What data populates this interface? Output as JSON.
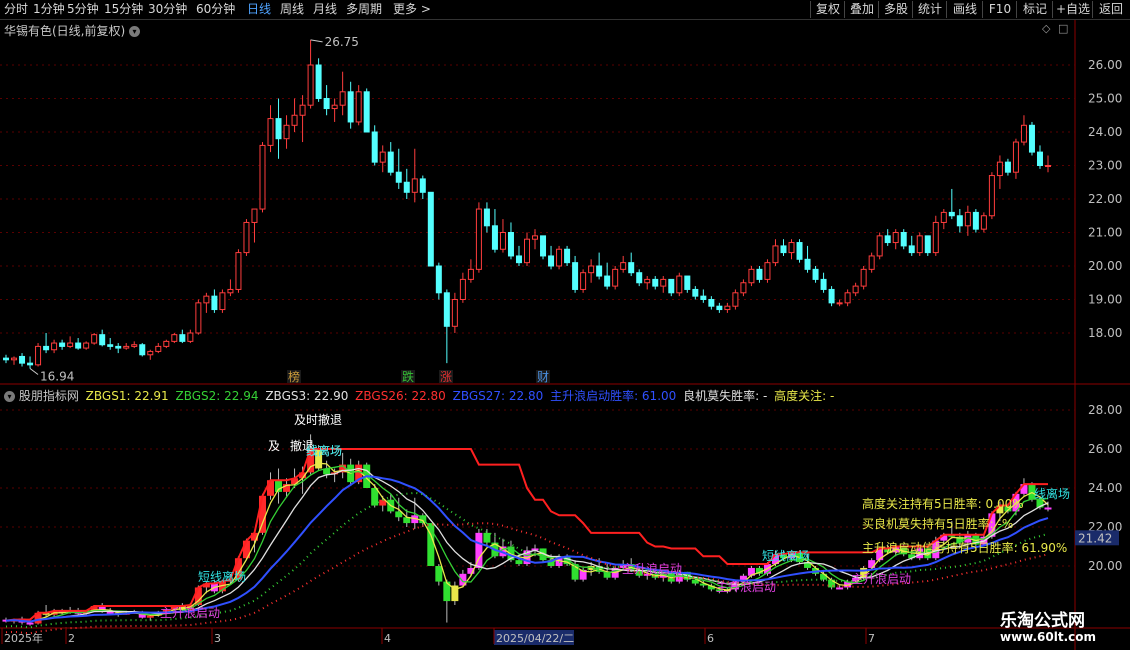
{
  "toolbar": {
    "timeframes": [
      "分时",
      "1分钟",
      "5分钟",
      "15分钟",
      "30分钟",
      "60分钟",
      "日线",
      "周线",
      "月线",
      "多周期",
      "更多"
    ],
    "active_timeframe": "日线",
    "right_buttons": [
      "复权",
      "叠加",
      "多股",
      "统计",
      "画线",
      "F10",
      "标记",
      "+自选",
      "返回"
    ]
  },
  "main_panel": {
    "title": "华锡有色(日线,前复权)",
    "y_ticks": [
      "26.00",
      "25.00",
      "24.00",
      "23.00",
      "22.00",
      "21.00",
      "20.00",
      "19.00",
      "18.00"
    ],
    "high_label": "26.75",
    "low_label": "16.94",
    "event_markers": [
      {
        "label": "榜",
        "color": "#c89a3a"
      },
      {
        "label": "跌",
        "color": "#35c035"
      },
      {
        "label": "涨",
        "color": "#e03030"
      },
      {
        "label": "财",
        "color": "#4a90e0"
      }
    ]
  },
  "indicator_panel": {
    "title": "股朋指标网",
    "legend": [
      {
        "text": "ZBGS1: 22.91",
        "color": "#e8e84a"
      },
      {
        "text": "ZBGS2: 22.94",
        "color": "#35d035"
      },
      {
        "text": "ZBGS3: 22.90",
        "color": "#e0e0e0"
      },
      {
        "text": "ZBGS26: 22.80",
        "color": "#ff3030"
      },
      {
        "text": "ZBGS27: 22.80",
        "color": "#3050ff"
      },
      {
        "text": "主升浪启动胜率: 61.00",
        "color": "#3050ff"
      },
      {
        "text": "良机莫失胜率: -",
        "color": "#e0e0e0"
      },
      {
        "text": "高度关注: -",
        "color": "#e8e84a"
      }
    ],
    "y_ticks": [
      "28.00",
      "26.00",
      "24.00",
      "22.00",
      "20.00"
    ],
    "current_value": "21.42",
    "signals": [
      {
        "text": "及时撤退",
        "color": "#ffffff"
      },
      {
        "text": "及",
        "color": "#ffffff"
      },
      {
        "text": "撤退",
        "color": "#ffffff"
      },
      {
        "text": "线离场",
        "color": "#ffffff"
      },
      {
        "text": "线离场",
        "color": "#30e0e0"
      },
      {
        "text": "短线离场",
        "color": "#30e0e0"
      },
      {
        "text": "短线离场",
        "color": "#30e0e0"
      },
      {
        "text": "主升浪启动",
        "color": "#e040e0"
      },
      {
        "text": "主升浪启动",
        "color": "#e040e0"
      },
      {
        "text": "主升浪启动",
        "color": "#e040e0"
      },
      {
        "text": "主升浪启动",
        "color": "#e040e0"
      }
    ],
    "stats": [
      {
        "text": "高度关注持有5日胜率:  0.00%",
        "color": "#e8e84a"
      },
      {
        "text": "买良机莫失持有5日胜率: -%",
        "color": "#e8e84a"
      },
      {
        "text": "主升浪启动信号持有5日胜率:  61.90%",
        "color": "#e8e84a"
      }
    ]
  },
  "x_axis": {
    "labels": [
      "2025年",
      "2",
      "3",
      "4",
      "2025/04/22/二",
      "6",
      "7"
    ]
  },
  "watermark": {
    "title": "乐淘公式网",
    "url": "www.60lt.com"
  },
  "colors": {
    "up": "#ff3d3d",
    "down": "#54ffff",
    "axis": "#8b0000"
  },
  "chart_data": {
    "type": "candlestick",
    "ylim": [
      17.0,
      27.0
    ],
    "candles": [
      [
        17.25,
        17.35,
        17.1,
        17.2
      ],
      [
        17.2,
        17.3,
        17.05,
        17.25
      ],
      [
        17.3,
        17.4,
        17.0,
        17.1
      ],
      [
        17.1,
        17.3,
        16.94,
        17.05
      ],
      [
        17.05,
        17.7,
        17.0,
        17.6
      ],
      [
        17.6,
        18.0,
        17.4,
        17.5
      ],
      [
        17.5,
        17.8,
        17.4,
        17.7
      ],
      [
        17.7,
        17.8,
        17.5,
        17.6
      ],
      [
        17.6,
        17.9,
        17.55,
        17.7
      ],
      [
        17.7,
        17.85,
        17.5,
        17.55
      ],
      [
        17.55,
        17.75,
        17.5,
        17.7
      ],
      [
        17.7,
        18.0,
        17.65,
        17.95
      ],
      [
        17.95,
        18.1,
        17.6,
        17.65
      ],
      [
        17.65,
        17.85,
        17.5,
        17.6
      ],
      [
        17.6,
        17.7,
        17.4,
        17.55
      ],
      [
        17.55,
        17.7,
        17.5,
        17.6
      ],
      [
        17.6,
        17.75,
        17.55,
        17.65
      ],
      [
        17.65,
        17.7,
        17.3,
        17.35
      ],
      [
        17.35,
        17.5,
        17.2,
        17.45
      ],
      [
        17.45,
        17.7,
        17.4,
        17.6
      ],
      [
        17.6,
        17.8,
        17.55,
        17.75
      ],
      [
        17.75,
        18.0,
        17.7,
        17.95
      ],
      [
        17.95,
        18.1,
        17.7,
        17.75
      ],
      [
        17.75,
        18.1,
        17.7,
        18.0
      ],
      [
        18.0,
        19.0,
        17.95,
        18.9
      ],
      [
        18.9,
        19.2,
        18.6,
        19.1
      ],
      [
        19.1,
        19.3,
        18.6,
        18.7
      ],
      [
        18.7,
        19.3,
        18.6,
        19.2
      ],
      [
        19.2,
        19.6,
        19.1,
        19.3
      ],
      [
        19.3,
        20.5,
        19.2,
        20.4
      ],
      [
        20.4,
        21.4,
        20.3,
        21.3
      ],
      [
        21.3,
        21.6,
        20.7,
        21.7
      ],
      [
        21.7,
        23.7,
        21.6,
        23.6
      ],
      [
        23.6,
        24.8,
        23.4,
        24.4
      ],
      [
        24.4,
        25.0,
        23.2,
        23.8
      ],
      [
        23.8,
        24.5,
        23.5,
        24.2
      ],
      [
        24.2,
        25.0,
        24.0,
        24.5
      ],
      [
        24.5,
        25.1,
        23.7,
        24.8
      ],
      [
        24.8,
        26.75,
        24.7,
        26.0
      ],
      [
        26.0,
        26.2,
        24.9,
        25.0
      ],
      [
        25.0,
        25.4,
        24.5,
        24.7
      ],
      [
        24.7,
        25.0,
        24.3,
        24.8
      ],
      [
        24.8,
        25.8,
        24.5,
        25.2
      ],
      [
        25.2,
        25.5,
        24.1,
        24.3
      ],
      [
        24.3,
        25.4,
        24.2,
        25.2
      ],
      [
        25.2,
        25.3,
        24.0,
        24.0
      ],
      [
        24.0,
        24.2,
        23.0,
        23.1
      ],
      [
        23.1,
        23.6,
        22.8,
        23.4
      ],
      [
        23.4,
        23.7,
        22.7,
        22.8
      ],
      [
        22.8,
        23.5,
        22.3,
        22.5
      ],
      [
        22.5,
        22.9,
        22.0,
        22.2
      ],
      [
        22.2,
        23.5,
        21.9,
        22.6
      ],
      [
        22.6,
        22.7,
        22.0,
        22.2
      ],
      [
        22.2,
        20.5,
        20.0,
        20.0
      ],
      [
        20.0,
        20.1,
        19.0,
        19.2
      ],
      [
        19.2,
        19.3,
        17.1,
        18.2
      ],
      [
        18.2,
        19.2,
        18.0,
        19.0
      ],
      [
        19.0,
        19.8,
        18.9,
        19.6
      ],
      [
        19.6,
        20.2,
        19.5,
        19.9
      ],
      [
        19.9,
        21.9,
        19.8,
        21.7
      ],
      [
        21.7,
        21.9,
        21.0,
        21.2
      ],
      [
        21.2,
        21.7,
        20.4,
        20.5
      ],
      [
        20.5,
        21.4,
        20.4,
        21.0
      ],
      [
        21.0,
        21.3,
        20.2,
        20.3
      ],
      [
        20.3,
        20.6,
        20.0,
        20.1
      ],
      [
        20.1,
        21.0,
        20.0,
        20.8
      ],
      [
        20.8,
        21.1,
        20.5,
        20.9
      ],
      [
        20.9,
        20.9,
        20.2,
        20.3
      ],
      [
        20.3,
        20.6,
        19.9,
        20.0
      ],
      [
        20.0,
        20.6,
        19.9,
        20.5
      ],
      [
        20.5,
        20.6,
        20.0,
        20.1
      ],
      [
        20.1,
        20.3,
        19.2,
        19.3
      ],
      [
        19.3,
        19.9,
        19.2,
        19.8
      ],
      [
        19.8,
        20.2,
        19.5,
        20.0
      ],
      [
        20.0,
        20.4,
        19.6,
        19.7
      ],
      [
        19.7,
        20.1,
        19.3,
        19.4
      ],
      [
        19.4,
        20.0,
        19.3,
        19.9
      ],
      [
        19.9,
        20.3,
        19.8,
        20.1
      ],
      [
        20.1,
        20.4,
        19.7,
        19.8
      ],
      [
        19.8,
        19.9,
        19.4,
        19.5
      ],
      [
        19.5,
        19.7,
        19.3,
        19.6
      ],
      [
        19.6,
        19.7,
        19.3,
        19.4
      ],
      [
        19.4,
        19.7,
        19.2,
        19.6
      ],
      [
        19.6,
        19.6,
        19.1,
        19.2
      ],
      [
        19.2,
        19.8,
        19.1,
        19.7
      ],
      [
        19.7,
        19.7,
        19.2,
        19.3
      ],
      [
        19.3,
        19.4,
        19.0,
        19.1
      ],
      [
        19.1,
        19.3,
        18.9,
        19.0
      ],
      [
        19.0,
        19.1,
        18.7,
        18.8
      ],
      [
        18.8,
        18.9,
        18.6,
        18.7
      ],
      [
        18.7,
        18.9,
        18.6,
        18.8
      ],
      [
        18.8,
        19.3,
        18.7,
        19.2
      ],
      [
        19.2,
        19.6,
        19.1,
        19.5
      ],
      [
        19.5,
        20.0,
        19.4,
        19.9
      ],
      [
        19.9,
        20.0,
        19.5,
        19.6
      ],
      [
        19.6,
        20.2,
        19.5,
        20.1
      ],
      [
        20.1,
        20.8,
        20.0,
        20.6
      ],
      [
        20.6,
        20.8,
        20.3,
        20.4
      ],
      [
        20.4,
        20.8,
        20.2,
        20.7
      ],
      [
        20.7,
        20.8,
        20.1,
        20.2
      ],
      [
        20.2,
        20.6,
        19.8,
        19.9
      ],
      [
        19.9,
        20.0,
        19.5,
        19.6
      ],
      [
        19.6,
        19.8,
        19.2,
        19.3
      ],
      [
        19.3,
        19.4,
        18.8,
        18.9
      ],
      [
        18.9,
        19.0,
        18.8,
        18.9
      ],
      [
        18.9,
        19.3,
        18.8,
        19.2
      ],
      [
        19.2,
        19.5,
        19.1,
        19.4
      ],
      [
        19.4,
        20.0,
        19.3,
        19.9
      ],
      [
        19.9,
        20.4,
        19.8,
        20.3
      ],
      [
        20.3,
        21.0,
        20.2,
        20.9
      ],
      [
        20.9,
        21.1,
        20.6,
        20.7
      ],
      [
        20.7,
        21.1,
        20.5,
        21.0
      ],
      [
        21.0,
        21.1,
        20.5,
        20.6
      ],
      [
        20.6,
        20.9,
        20.3,
        20.4
      ],
      [
        20.4,
        21.0,
        20.3,
        20.9
      ],
      [
        20.9,
        20.9,
        20.3,
        20.4
      ],
      [
        20.4,
        21.5,
        20.3,
        21.3
      ],
      [
        21.3,
        21.7,
        21.1,
        21.6
      ],
      [
        21.6,
        22.3,
        21.4,
        21.5
      ],
      [
        21.5,
        21.7,
        21.0,
        21.2
      ],
      [
        21.2,
        21.8,
        20.9,
        21.6
      ],
      [
        21.6,
        21.7,
        21.0,
        21.1
      ],
      [
        21.1,
        21.6,
        21.0,
        21.5
      ],
      [
        21.5,
        22.8,
        21.4,
        22.7
      ],
      [
        22.7,
        23.3,
        22.3,
        23.1
      ],
      [
        23.1,
        23.2,
        22.7,
        22.8
      ],
      [
        22.8,
        23.8,
        22.6,
        23.7
      ],
      [
        23.7,
        24.5,
        23.6,
        24.2
      ],
      [
        24.2,
        24.3,
        23.3,
        23.4
      ],
      [
        23.4,
        23.6,
        22.9,
        23.0
      ],
      [
        23.0,
        23.3,
        22.8,
        23.0
      ]
    ]
  }
}
